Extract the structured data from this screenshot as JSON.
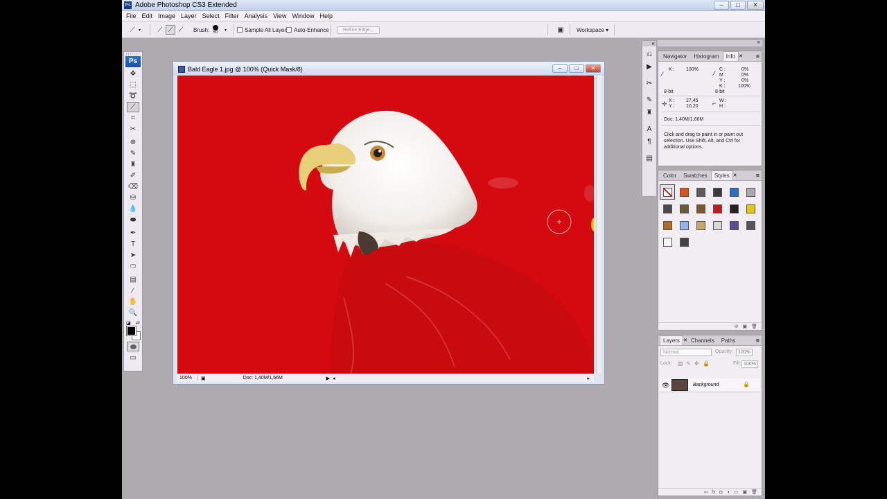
{
  "app": {
    "title": "Adobe Photoshop CS3 Extended",
    "ps_icon": "Ps"
  },
  "window_buttons": [
    "–",
    "□",
    "✕"
  ],
  "menu": [
    "File",
    "Edit",
    "Image",
    "Layer",
    "Select",
    "Filter",
    "Analysis",
    "View",
    "Window",
    "Help"
  ],
  "options": {
    "brush_label": "Brush:",
    "brush_size": "50",
    "sample_all_layers": "Sample All Layers",
    "auto_enhance": "Auto-Enhance",
    "refine_edge": "Refine Edge...",
    "workspace": "Workspace ▾"
  },
  "toolbox": {
    "logo": "Ps"
  },
  "document": {
    "title": "Bald Eagle 1.jpg @ 100% (Quick Mask/8)",
    "zoom": "100%",
    "doc_size": "Doc: 1,40M/1,66M",
    "mask_color": "#d40a10"
  },
  "panels": {
    "info_tabs": [
      "Navigator",
      "Histogram",
      "Info"
    ],
    "info": {
      "k_label": "K :",
      "k_value": "100%",
      "c_label": "C :",
      "c_value": "0%",
      "m_label": "M :",
      "m_value": "0%",
      "y_label": "Y :",
      "y_value": "0%",
      "k2_label": "K :",
      "k2_value": "100%",
      "bit_left": "8-bit",
      "bit_right": "8-bit",
      "x_label": "X :",
      "x_value": "27,45",
      "y2_label": "Y :",
      "y2_value": "10,20",
      "w_label": "W :",
      "h_label": "H :",
      "doc": "Doc: 1,40M/1,66M",
      "hint": "Click and drag to paint in or paint out selection.  Use Shift, Alt, and Ctrl for additional options."
    },
    "style_tabs": [
      "Color",
      "Swatches",
      "Styles"
    ],
    "style_colors": [
      "#ffffff",
      "#d9531b",
      "#5a5a5a",
      "#3a3a3a",
      "#2a6dc2",
      "#aaaaaa",
      "#4a4a4a",
      "#6b5a3a",
      "#7a5a2a",
      "#c01b1b",
      "#222222",
      "#e6c612",
      "#b06a2a",
      "#8fb6e6",
      "#c7a66a",
      "#d8d8d8",
      "#5a4a9a",
      "#555555",
      "#f5f5f5",
      "#444444"
    ],
    "layers_tabs": [
      "Layers",
      "Channels",
      "Paths"
    ],
    "blend_mode": "Normal",
    "opacity_label": "Opacity:",
    "opacity_value": "100%",
    "lock_label": "Lock:",
    "fill_label": "Fill:",
    "fill_value": "100%",
    "layer_name": "Background"
  }
}
